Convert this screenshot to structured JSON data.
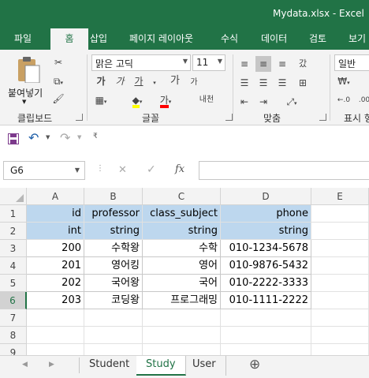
{
  "window": {
    "title": "Mydata.xlsx  -  Excel"
  },
  "ribbon_tabs": [
    "파일",
    "홈",
    "삽입",
    "페이지 레이아웃",
    "수식",
    "데이터",
    "검토",
    "보기"
  ],
  "ribbon": {
    "clipboard": {
      "paste_label": "붙여넣기",
      "group_label": "클립보드"
    },
    "font": {
      "font_name": "맑은 고딕",
      "font_size": "11",
      "group_label": "글꼴",
      "bold": "가",
      "italic": "가",
      "underline": "가",
      "grow": "가",
      "shrink": "가",
      "phonetic": "내천"
    },
    "alignment": {
      "group_label": "맞춤",
      "wrap": "갔",
      "merge": ""
    },
    "number": {
      "format": "일반",
      "group_label": "표시 형"
    }
  },
  "formula_bar": {
    "name_box": "G6",
    "cancel": "✕",
    "enter": "✓",
    "fx": "fx",
    "formula": ""
  },
  "columns": [
    "A",
    "B",
    "C",
    "D",
    "E"
  ],
  "rows": [
    "1",
    "2",
    "3",
    "4",
    "5",
    "6",
    "7",
    "8",
    "9"
  ],
  "selected_row": "6",
  "table": [
    [
      "id",
      "professor",
      "class_subject",
      "phone"
    ],
    [
      "int",
      "string",
      "string",
      "string"
    ],
    [
      "200",
      "수학왕",
      "수학",
      "010-1234-5678"
    ],
    [
      "201",
      "영어킹",
      "영어",
      "010-9876-5432"
    ],
    [
      "202",
      "국어왕",
      "국어",
      "010-2222-3333"
    ],
    [
      "203",
      "코딩왕",
      "프로그래밍",
      "010-1111-2222"
    ]
  ],
  "sheets": [
    "Student",
    "Study",
    "User"
  ],
  "active_sheet": "Study",
  "colors": {
    "excel_green": "#217346",
    "header_fill": "#bdd7ee"
  }
}
